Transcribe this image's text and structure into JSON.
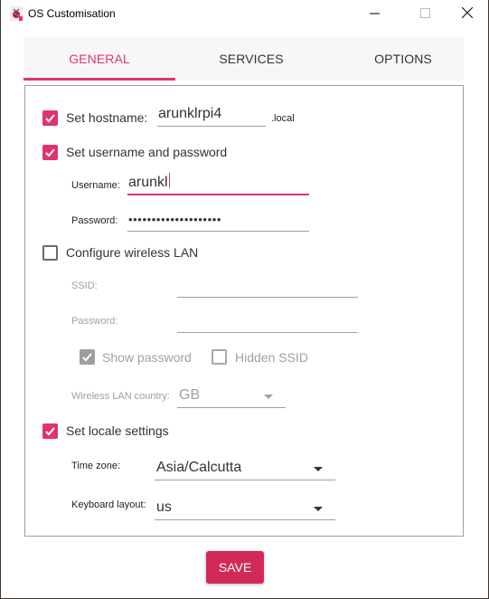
{
  "window": {
    "title": "OS Customisation",
    "app_icon": "raspberry-pi-icon",
    "controls": {
      "minimize": "minimize-icon",
      "maximize": "maximize-icon",
      "close": "close-icon"
    }
  },
  "tabs": [
    {
      "label": "GENERAL",
      "active": true
    },
    {
      "label": "SERVICES",
      "active": false
    },
    {
      "label": "OPTIONS",
      "active": false
    }
  ],
  "general": {
    "hostname": {
      "label": "Set hostname:",
      "checked": true,
      "value": "arunklrpi4",
      "suffix": ".local"
    },
    "user": {
      "label": "Set username and password",
      "checked": true,
      "username_label": "Username:",
      "username_value": "arunkl",
      "password_label": "Password:",
      "password_value": "••••••••••••••••••••"
    },
    "wlan": {
      "label": "Configure wireless LAN",
      "checked": false,
      "ssid_label": "SSID:",
      "ssid_value": "",
      "password_label": "Password:",
      "password_value": "",
      "show_password_label": "Show password",
      "show_password_checked": true,
      "hidden_ssid_label": "Hidden SSID",
      "hidden_ssid_checked": false,
      "country_label": "Wireless LAN country:",
      "country_value": "GB"
    },
    "locale": {
      "label": "Set locale settings",
      "checked": true,
      "timezone_label": "Time zone:",
      "timezone_value": "Asia/Calcutta",
      "keyboard_label": "Keyboard layout:",
      "keyboard_value": "us"
    }
  },
  "footer": {
    "save_label": "SAVE"
  },
  "colors": {
    "accent": "#e0356a",
    "save_button": "#d12a58",
    "disabled": "#a0a0a0"
  }
}
